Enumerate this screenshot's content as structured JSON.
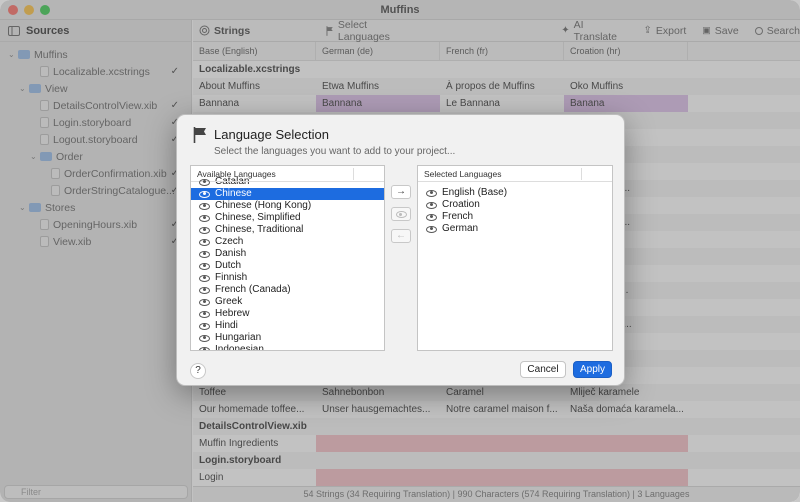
{
  "window": {
    "title": "Muffins"
  },
  "sidebar": {
    "title": "Sources",
    "filter_placeholder": "Filter",
    "tree": [
      {
        "label": "Muffins",
        "kind": "folder",
        "indent": 0,
        "chev": "v",
        "checked": false
      },
      {
        "label": "Localizable.xcstrings",
        "kind": "file",
        "indent": 2,
        "chev": "",
        "checked": true
      },
      {
        "label": "View",
        "kind": "folder",
        "indent": 1,
        "chev": "v",
        "checked": false
      },
      {
        "label": "DetailsControlView.xib",
        "kind": "file",
        "indent": 2,
        "chev": "",
        "checked": true
      },
      {
        "label": "Login.storyboard",
        "kind": "file",
        "indent": 2,
        "chev": "",
        "checked": true
      },
      {
        "label": "Logout.storyboard",
        "kind": "file",
        "indent": 2,
        "chev": "",
        "checked": true
      },
      {
        "label": "Order",
        "kind": "folder",
        "indent": 2,
        "chev": "v",
        "checked": false
      },
      {
        "label": "OrderConfirmation.xib",
        "kind": "file",
        "indent": 3,
        "chev": "",
        "checked": true
      },
      {
        "label": "OrderStringCatalogue...",
        "kind": "file",
        "indent": 3,
        "chev": "",
        "checked": true
      },
      {
        "label": "Stores",
        "kind": "folder",
        "indent": 1,
        "chev": "v",
        "checked": false
      },
      {
        "label": "OpeningHours.xib",
        "kind": "file",
        "indent": 2,
        "chev": "",
        "checked": true
      },
      {
        "label": "View.xib",
        "kind": "file",
        "indent": 2,
        "chev": "",
        "checked": true
      }
    ]
  },
  "toolbar": {
    "strings": "Strings",
    "select_languages": "Select Languages",
    "ai_translate": "AI Translate",
    "export": "Export",
    "save": "Save",
    "search": "Search"
  },
  "columns": [
    "Base (English)",
    "German (de)",
    "French (fr)",
    "Croation (hr)"
  ],
  "rows": [
    {
      "type": "group",
      "cells": [
        "Localizable.xcstrings",
        "",
        "",
        ""
      ]
    },
    {
      "type": "row",
      "cells": [
        "About Muffins",
        "Etwa Muffins",
        "À propos de Muffins",
        "Oko Muffins"
      ],
      "hl": [
        "",
        "",
        "",
        ""
      ]
    },
    {
      "type": "row",
      "cells": [
        "Bannana",
        "Bannana",
        "Le Bannana",
        "Banana"
      ],
      "hl": [
        "",
        "purple",
        "",
        "purple"
      ]
    },
    {
      "type": "row",
      "cells": [
        "",
        "",
        "",
        "ljeni muff..."
      ],
      "hl": [
        "",
        "",
        "",
        ""
      ]
    },
    {
      "type": "row",
      "cells": [
        "",
        "",
        "",
        ""
      ],
      "hl": [
        "",
        "",
        "",
        ""
      ]
    },
    {
      "type": "row",
      "cells": [
        "",
        "",
        "",
        "uffin s rum..."
      ],
      "hl": [
        "",
        "",
        "",
        ""
      ]
    },
    {
      "type": "row",
      "cells": [
        "",
        "",
        "",
        ""
      ],
      "hl": [
        "",
        "",
        "",
        ""
      ]
    },
    {
      "type": "row",
      "cells": [
        "",
        "",
        "",
        "olada s pun..."
      ],
      "hl": [
        "",
        "",
        "",
        ""
      ]
    },
    {
      "type": "row",
      "cells": [
        "",
        "",
        "",
        ""
      ],
      "hl": [
        "",
        "",
        "",
        ""
      ]
    },
    {
      "type": "row",
      "cells": [
        "",
        "",
        "",
        "limuna u de..."
      ],
      "hl": [
        "",
        "",
        "",
        ""
      ]
    },
    {
      "type": "row",
      "cells": [
        "",
        "",
        "",
        ""
      ],
      "hl": [
        "",
        "",
        "",
        ""
      ]
    },
    {
      "type": "row",
      "cells": [
        "",
        "",
        "",
        ""
      ],
      "hl": [
        "",
        "",
        "",
        ""
      ]
    },
    {
      "type": "row",
      "cells": [
        "",
        "",
        "",
        ""
      ],
      "hl": [
        "",
        "",
        "",
        ""
      ]
    },
    {
      "type": "row",
      "cells": [
        "",
        "",
        "",
        "berry punje..."
      ],
      "hl": [
        "",
        "",
        "",
        ""
      ]
    },
    {
      "type": "row",
      "cells": [
        "",
        "",
        "",
        "mela"
      ],
      "hl": [
        "",
        "",
        "",
        ""
      ]
    },
    {
      "type": "row",
      "cells": [
        "",
        "",
        "",
        "amela, solje..."
      ],
      "hl": [
        "",
        "",
        "",
        ""
      ]
    },
    {
      "type": "row",
      "cells": [
        "",
        "",
        "",
        ""
      ],
      "hl": [
        "",
        "",
        "",
        ""
      ]
    },
    {
      "type": "row",
      "cells": [
        "",
        "",
        "",
        ""
      ],
      "hl": [
        "",
        "",
        "",
        ""
      ]
    },
    {
      "type": "row",
      "cells": [
        "",
        "",
        "",
        ""
      ],
      "hl": [
        "",
        "",
        "",
        ""
      ]
    },
    {
      "type": "row",
      "cells": [
        "Toffee",
        "Sahnebonbon",
        "Caramel",
        "Mliječ karamele"
      ],
      "hl": [
        "",
        "",
        "",
        ""
      ]
    },
    {
      "type": "row",
      "cells": [
        "Our homemade toffee...",
        "Unser hausgemachtes...",
        "Notre caramel maison f...",
        "Naša domaća karamela..."
      ],
      "hl": [
        "",
        "",
        "",
        ""
      ]
    },
    {
      "type": "group",
      "cells": [
        "DetailsControlView.xib",
        "",
        "",
        ""
      ]
    },
    {
      "type": "row",
      "cells": [
        "Muffin Ingredients",
        "",
        "",
        ""
      ],
      "hl": [
        "",
        "red",
        "red",
        "red"
      ]
    },
    {
      "type": "group",
      "cells": [
        "Login.storyboard",
        "",
        "",
        ""
      ]
    },
    {
      "type": "row",
      "cells": [
        "Login",
        "",
        "",
        ""
      ],
      "hl": [
        "",
        "red",
        "red",
        "red"
      ]
    }
  ],
  "status": "54 Strings (34 Requiring Translation) | 990 Characters (574 Requiring Translation) | 3 Languages",
  "dialog": {
    "title": "Language Selection",
    "subtitle": "Select the languages you want to add to your project...",
    "available_header": "Available Languages",
    "selected_header": "Selected Languages",
    "available": [
      "Catalan",
      "Chinese",
      "Chinese (Hong Kong)",
      "Chinese, Simplified",
      "Chinese, Traditional",
      "Czech",
      "Danish",
      "Dutch",
      "Finnish",
      "French (Canada)",
      "Greek",
      "Hebrew",
      "Hindi",
      "Hungarian",
      "Indonesian"
    ],
    "available_selected_index": 1,
    "selected": [
      "English (Base)",
      "Croation",
      "French",
      "German"
    ],
    "add_glyph": "→",
    "remove_glyph": "←",
    "help": "?",
    "cancel": "Cancel",
    "apply": "Apply",
    "accent": "#1d6ce0"
  }
}
